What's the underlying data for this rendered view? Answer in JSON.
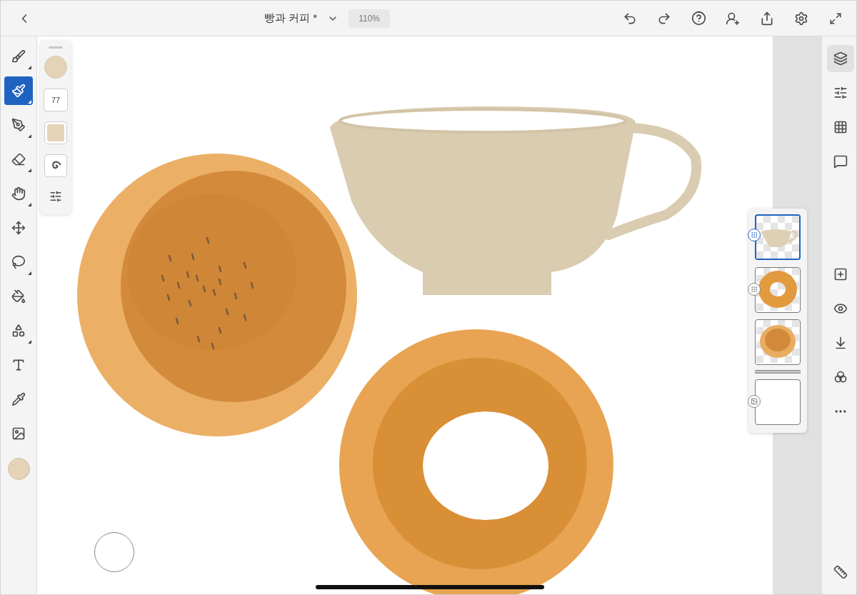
{
  "document": {
    "title": "빵과 커피 *",
    "zoom": "110%"
  },
  "tools": [
    {
      "kind": "pixel-brush",
      "submenu": true,
      "selected": false
    },
    {
      "kind": "live-brush",
      "submenu": true,
      "selected": true
    },
    {
      "kind": "vector-brush",
      "submenu": true,
      "selected": false
    },
    {
      "kind": "eraser",
      "submenu": true,
      "selected": false
    },
    {
      "kind": "smudge",
      "submenu": true,
      "selected": false
    },
    {
      "kind": "transform",
      "submenu": false,
      "selected": false
    },
    {
      "kind": "lasso",
      "submenu": true,
      "selected": false
    },
    {
      "kind": "fill",
      "submenu": false,
      "selected": false
    },
    {
      "kind": "shapes",
      "submenu": true,
      "selected": false
    },
    {
      "kind": "text",
      "submenu": false,
      "selected": false
    },
    {
      "kind": "eyedropper",
      "submenu": false,
      "selected": false
    },
    {
      "kind": "image",
      "submenu": false,
      "selected": false
    }
  ],
  "brush_panel": {
    "size": "77"
  },
  "side_tools": [
    {
      "kind": "layers",
      "selected": true
    },
    {
      "kind": "properties",
      "selected": false
    },
    {
      "kind": "grid",
      "selected": false
    },
    {
      "kind": "comments",
      "selected": false
    },
    {
      "kind": "add-layer",
      "selected": false
    },
    {
      "kind": "visibility",
      "selected": false
    },
    {
      "kind": "merge",
      "selected": false
    },
    {
      "kind": "blend",
      "selected": false
    },
    {
      "kind": "more",
      "selected": false
    }
  ],
  "layers": [
    {
      "kind": "cup",
      "selected": true
    },
    {
      "kind": "donut",
      "selected": false
    },
    {
      "kind": "bread",
      "selected": false
    },
    {
      "kind": "background",
      "selected": false
    }
  ]
}
